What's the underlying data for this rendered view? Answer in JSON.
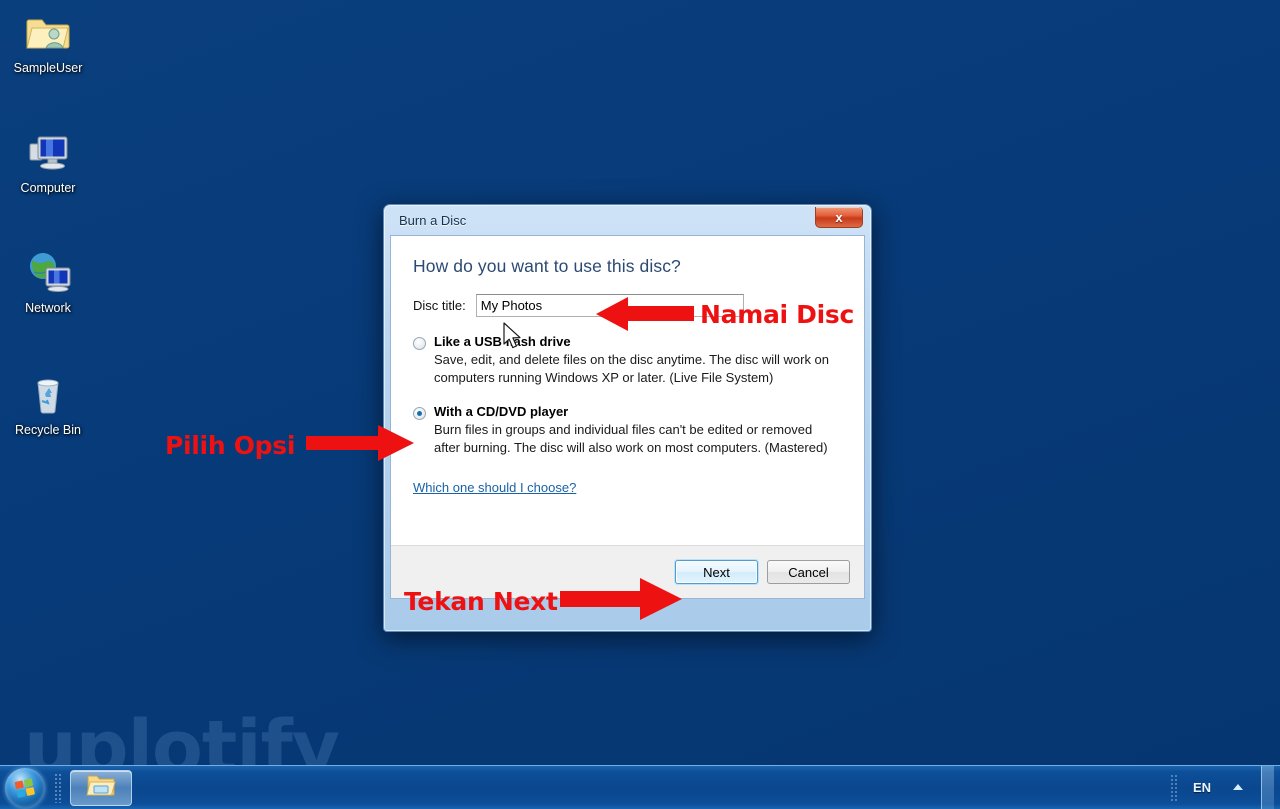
{
  "desktop": {
    "background_color": "#073a78",
    "watermark": "uplotify",
    "icons": [
      {
        "label": "SampleUser",
        "icon": "user-folder-icon"
      },
      {
        "label": "Computer",
        "icon": "computer-monitor-icon"
      },
      {
        "label": "Network",
        "icon": "network-globe-icon"
      },
      {
        "label": "Recycle Bin",
        "icon": "recycle-bin-icon"
      }
    ]
  },
  "dialog": {
    "title": "Burn a Disc",
    "close_label": "x",
    "heading": "How do you want to use this disc?",
    "disc_title_label": "Disc title:",
    "disc_title_value": "My Photos",
    "options": [
      {
        "title": "Like a USB flash drive",
        "description": "Save, edit, and delete files on the disc anytime. The disc will work on computers running Windows XP or later. (Live File System)",
        "checked": false
      },
      {
        "title": "With a CD/DVD player",
        "description": "Burn files in groups and individual files can't be edited or removed after burning. The disc will also work on most computers. (Mastered)",
        "checked": true
      }
    ],
    "help_link": "Which one should I choose?",
    "buttons": {
      "next": "Next",
      "cancel": "Cancel"
    },
    "accent_color": "#2c4a73",
    "link_color": "#1962a8"
  },
  "annotations": {
    "color": "#ee1111",
    "items": [
      {
        "text": "Namai Disc",
        "arrow": "left"
      },
      {
        "text": "Pilih Opsi",
        "arrow": "right"
      },
      {
        "text": "Tekan Next",
        "arrow": "right"
      }
    ]
  },
  "taskbar": {
    "start_label": "start-orb",
    "pinned": [
      {
        "name": "windows-explorer",
        "icon": "folder-icon"
      }
    ],
    "tray": {
      "language": "EN",
      "chevron": "show-hidden-icons",
      "show_desktop": "show-desktop-button"
    }
  }
}
